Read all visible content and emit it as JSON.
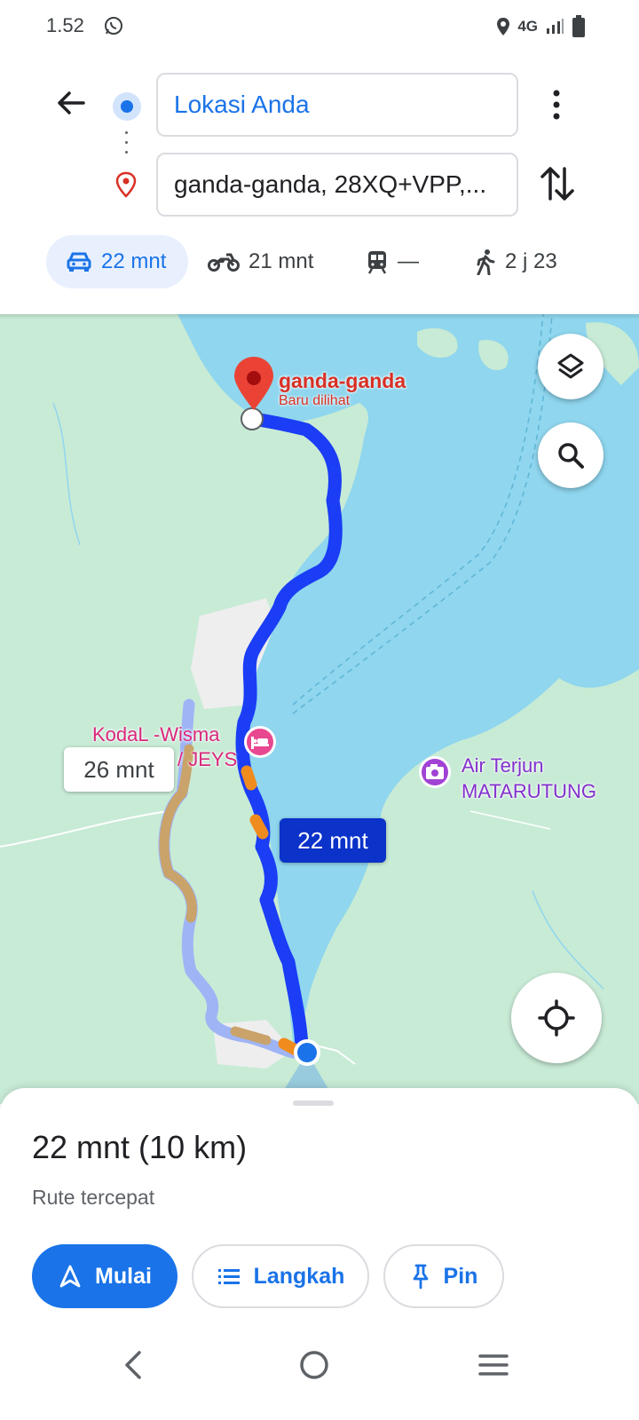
{
  "status_bar": {
    "time": "1.52",
    "network": "4G",
    "icons": [
      "whatsapp-icon",
      "location-icon",
      "signal-icon",
      "battery-icon"
    ]
  },
  "directions": {
    "origin": "Lokasi Anda",
    "destination": "ganda-ganda, 28XQ+VPP,..."
  },
  "modes": [
    {
      "name": "car",
      "icon": "car-icon",
      "label": "22 mnt",
      "selected": true
    },
    {
      "name": "motorcycle",
      "icon": "motorcycle-icon",
      "label": "21 mnt"
    },
    {
      "name": "transit",
      "icon": "train-icon",
      "label": "—"
    },
    {
      "name": "walk",
      "icon": "walking-icon",
      "label": "2 j 23"
    }
  ],
  "map": {
    "destination_name": "ganda-ganda",
    "destination_sub": "Baru dilihat",
    "poi_hotel_line1": "KodaL -Wisma",
    "poi_hotel_line2": "/ JEYS",
    "poi_falls_line1": "Air Terjun",
    "poi_falls_line2": "MATARUTUNG",
    "alt_route_time": "26 mnt",
    "main_route_time": "22 mnt",
    "colors": {
      "water": "#8fd6ee",
      "land": "#c8ebd6",
      "route_main": "#1a3df5",
      "route_alt": "#9fb4f5",
      "traffic_slow": "#f08c1e"
    }
  },
  "sheet": {
    "summary": "22 mnt (10 km)",
    "note": "Rute tercepat",
    "start_label": "Mulai",
    "steps_label": "Langkah",
    "pin_label": "Pin"
  }
}
